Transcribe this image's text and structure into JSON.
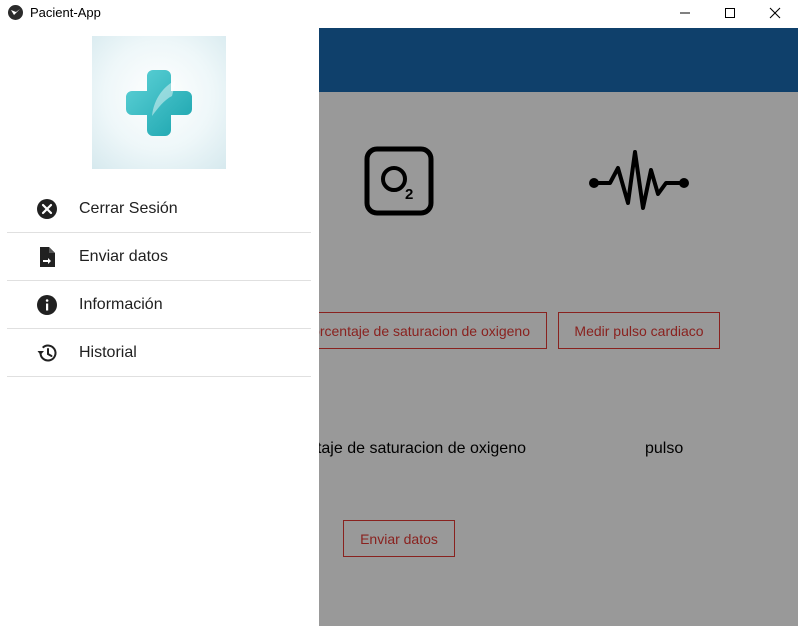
{
  "window": {
    "title": "Pacient-App",
    "controls": [
      "minimize-icon",
      "maximize-icon",
      "close-icon"
    ]
  },
  "colors": {
    "appbar": "#1a6bb3",
    "accent_red": "#e53935",
    "logo_teal": "#3fc1c9"
  },
  "drawer": {
    "logo_icon": "medical-cross-logo",
    "items": [
      {
        "label": "Cerrar Sesión",
        "icon": "close-circle-icon"
      },
      {
        "label": "Enviar datos",
        "icon": "file-send-icon"
      },
      {
        "label": "Información",
        "icon": "info-icon"
      },
      {
        "label": "Historial",
        "icon": "history-icon"
      }
    ]
  },
  "main": {
    "icons": [
      "o2-icon",
      "pulse-icon"
    ],
    "buttons": {
      "measure_o2": "orcentaje de saturacion de oxigeno",
      "measure_pulse": "Medir pulso cardiaco",
      "send": "Enviar datos"
    },
    "labels": {
      "o2": "taje de saturacion de oxigeno",
      "pulse": "pulso"
    }
  }
}
